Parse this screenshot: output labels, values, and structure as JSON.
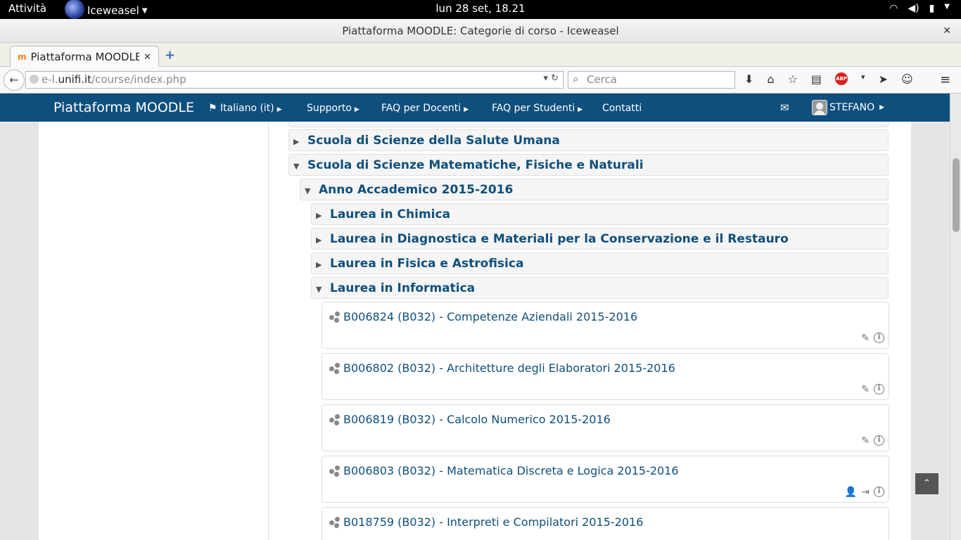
{
  "system": {
    "activities": "Attività",
    "app_name": "Iceweasel",
    "clock": "lun 28 set, 18.21"
  },
  "window": {
    "title": "Piattaforma MOODLE: Categorie di corso - Iceweasel"
  },
  "browser": {
    "tab_title": "Piattaforma MOODLE...",
    "url_prefix": "e-l.",
    "url_host": "unifi.it",
    "url_path": "/course/index.php",
    "search_placeholder": "Cerca"
  },
  "moodle": {
    "brand": "Piattaforma MOODLE",
    "menu": {
      "language": "Italiano (it)",
      "support": "Supporto",
      "faq_teachers": "FAQ per Docenti",
      "faq_students": "FAQ per Studenti",
      "contacts": "Contatti"
    },
    "user": "STEFANO"
  },
  "categories": {
    "salute": "Scuola di Scienze della Salute Umana",
    "mfn": "Scuola di Scienze Matematiche, Fisiche e Naturali",
    "anno": "Anno Accademico 2015-2016",
    "chimica": "Laurea in Chimica",
    "diagnostica": "Laurea in Diagnostica e Materiali per la Conservazione e il Restauro",
    "fisica": "Laurea in Fisica e Astrofisica",
    "informatica": "Laurea in Informatica"
  },
  "courses": [
    {
      "name": "B006824 (B032) - Competenze Aziendali 2015-2016"
    },
    {
      "name": "B006802 (B032) - Architetture degli Elaboratori 2015-2016"
    },
    {
      "name": "B006819 (B032) - Calcolo Numerico 2015-2016"
    },
    {
      "name": "B006803 (B032) - Matematica Discreta e Logica 2015-2016"
    },
    {
      "name": "B018759 (B032) - Interpreti e Compilatori 2015-2016"
    }
  ]
}
